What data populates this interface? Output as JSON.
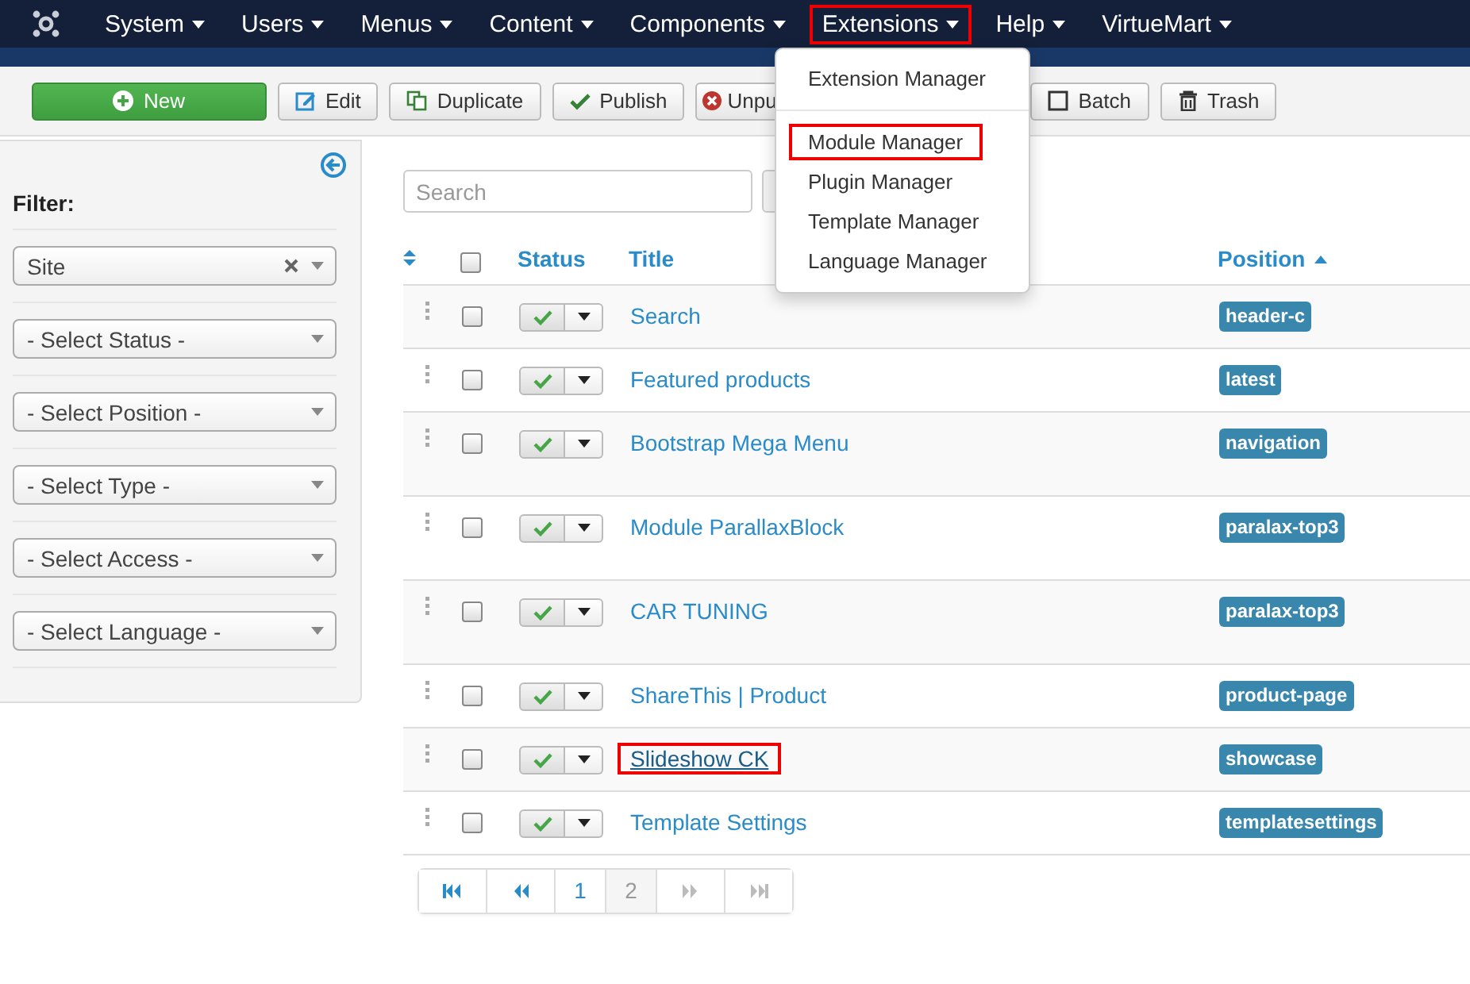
{
  "navbar": {
    "items": [
      {
        "label": "System",
        "highlighted": false
      },
      {
        "label": "Users",
        "highlighted": false
      },
      {
        "label": "Menus",
        "highlighted": false
      },
      {
        "label": "Content",
        "highlighted": false
      },
      {
        "label": "Components",
        "highlighted": false
      },
      {
        "label": "Extensions",
        "highlighted": true
      },
      {
        "label": "Help",
        "highlighted": false
      },
      {
        "label": "VirtueMart",
        "highlighted": false
      }
    ]
  },
  "dropdown": {
    "groups": [
      {
        "items": [
          {
            "label": "Extension Manager",
            "highlighted": false
          }
        ]
      },
      {
        "items": [
          {
            "label": "Module Manager",
            "highlighted": true
          },
          {
            "label": "Plugin Manager",
            "highlighted": false
          },
          {
            "label": "Template Manager",
            "highlighted": false
          },
          {
            "label": "Language Manager",
            "highlighted": false
          }
        ]
      }
    ]
  },
  "toolbar": {
    "buttons": [
      {
        "kind": "new",
        "label": "New"
      },
      {
        "kind": "edit",
        "label": "Edit"
      },
      {
        "kind": "duplicate",
        "label": "Duplicate"
      },
      {
        "kind": "publish",
        "label": "Publish"
      },
      {
        "kind": "unpublish",
        "label": "Unpu"
      },
      {
        "kind": "batch",
        "label": "Batch"
      },
      {
        "kind": "trash",
        "label": "Trash"
      }
    ]
  },
  "sidebar": {
    "title": "Filter:",
    "filters": [
      {
        "value": "Site",
        "clearable": true
      },
      {
        "value": "- Select Status -",
        "clearable": false
      },
      {
        "value": "- Select Position -",
        "clearable": false
      },
      {
        "value": "- Select Type -",
        "clearable": false
      },
      {
        "value": "- Select Access -",
        "clearable": false
      },
      {
        "value": "- Select Language -",
        "clearable": false
      }
    ]
  },
  "search": {
    "placeholder": "Search"
  },
  "table": {
    "select_all_checked": false,
    "columns": [
      {
        "label": "Status",
        "sorted": false
      },
      {
        "label": "Title",
        "sorted": false
      },
      {
        "label": "Position",
        "sorted": true
      }
    ],
    "rows": [
      {
        "title": "Search",
        "position": "header-c",
        "published": true,
        "checked": false,
        "tall": false,
        "highlighted": false
      },
      {
        "title": "Featured products",
        "position": "latest",
        "published": true,
        "checked": false,
        "tall": false,
        "highlighted": false
      },
      {
        "title": "Bootstrap Mega Menu",
        "position": "navigation",
        "published": true,
        "checked": false,
        "tall": true,
        "highlighted": false
      },
      {
        "title": "Module ParallaxBlock",
        "position": "paralax-top3",
        "published": true,
        "checked": false,
        "tall": true,
        "highlighted": false
      },
      {
        "title": "CAR TUNING",
        "position": "paralax-top3",
        "published": true,
        "checked": false,
        "tall": true,
        "highlighted": false
      },
      {
        "title": "ShareThis | Product",
        "position": "product-page",
        "published": true,
        "checked": false,
        "tall": false,
        "highlighted": false
      },
      {
        "title": "Slideshow CK",
        "position": "showcase",
        "published": true,
        "checked": false,
        "tall": false,
        "highlighted": true
      },
      {
        "title": "Template Settings",
        "position": "templatesettings",
        "published": true,
        "checked": false,
        "tall": false,
        "highlighted": false
      }
    ]
  },
  "pagination": {
    "nav": [
      {
        "kind": "first",
        "disabled": false
      },
      {
        "kind": "prev",
        "disabled": false
      },
      {
        "kind": "next",
        "disabled": true
      },
      {
        "kind": "last",
        "disabled": true
      }
    ],
    "pages": [
      {
        "label": "1",
        "selected": false
      },
      {
        "label": "2",
        "selected": true
      }
    ]
  }
}
